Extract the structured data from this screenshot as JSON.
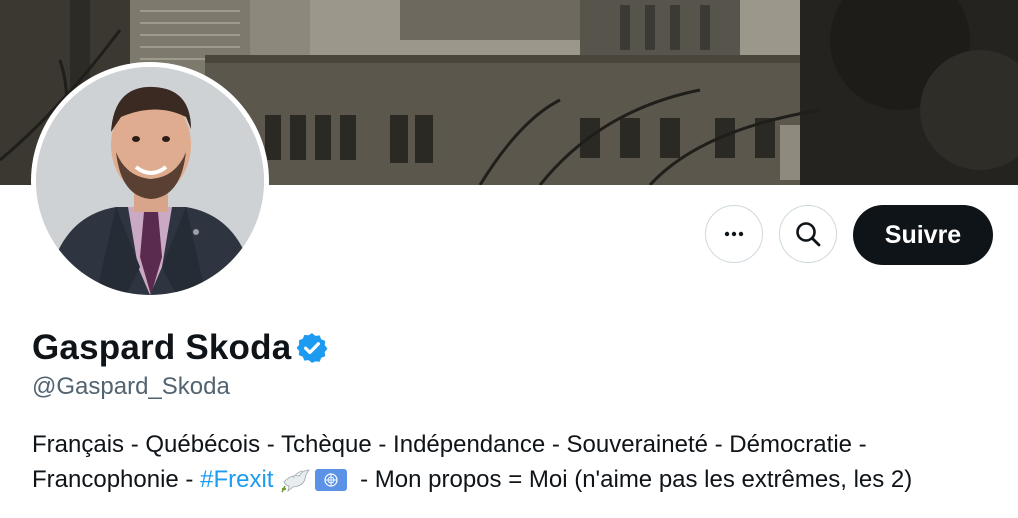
{
  "profile": {
    "display_name": "Gaspard Skoda",
    "handle": "@Gaspard_Skoda",
    "verified_icon": "verified-badge-icon",
    "banner_description_icon": "cityscape-banner",
    "avatar_icon": "profile-photo"
  },
  "actions": {
    "more_icon": "more-horizontal-icon",
    "search_icon": "search-icon",
    "follow_label": "Suivre"
  },
  "bio": {
    "line1": "Français - Québécois - Tchèque - Indépendance - Souveraineté - Démocratie -",
    "line2_before": "Francophonie - ",
    "hashtag": "#Frexit",
    "emoji_1": "dove-emoji-icon",
    "emoji_2": "united-nations-flag-icon",
    "line2_after": " - Mon propos = Moi (n'aime pas les extrêmes, les 2)"
  },
  "colors": {
    "text": "#0f1419",
    "secondary_text": "#536471",
    "link": "#1d9bf0",
    "follow_button_bg": "#0f1419",
    "border": "#cfd9de",
    "verified": "#1d9bf0"
  }
}
